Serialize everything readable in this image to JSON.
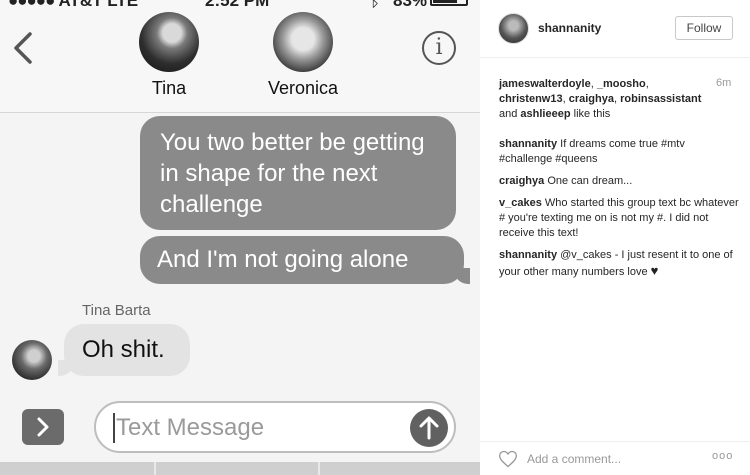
{
  "status_bar": {
    "carrier": "AT&T",
    "network": "LTE",
    "time": "2:52 PM",
    "battery_pct": "83%"
  },
  "conversation": {
    "contacts": [
      {
        "name": "Tina"
      },
      {
        "name": "Veronica"
      }
    ],
    "messages": [
      {
        "from": "me",
        "text": "You two better be getting in shape for the next challenge"
      },
      {
        "from": "me",
        "text": "And I'm not going alone"
      },
      {
        "from": "Tina Barta",
        "text": "Oh shit."
      }
    ],
    "sender_label": "Tina Barta",
    "input_placeholder": "Text Message"
  },
  "instagram": {
    "username": "shannanity",
    "follow_label": "Follow",
    "timestamp": "6m",
    "likes": {
      "users": [
        "jameswalterdoyle",
        "_moosho",
        "christenw13",
        "craighya",
        "robinsassistant",
        "ashlieeep"
      ],
      "suffix": "like this"
    },
    "comments": [
      {
        "user": "shannanity",
        "text": "If dreams come true #mtv #challenge #queens"
      },
      {
        "user": "craighya",
        "text": "One can dream..."
      },
      {
        "user": "v_cakes",
        "text": "Who started this group text bc whatever # you're texting me on is not my #. I did not receive this text!"
      },
      {
        "user": "shannanity",
        "text": "@v_cakes - I just resent it to one of your other many numbers love"
      }
    ],
    "add_comment_placeholder": "Add a comment...",
    "more_glyph": "ooo"
  }
}
